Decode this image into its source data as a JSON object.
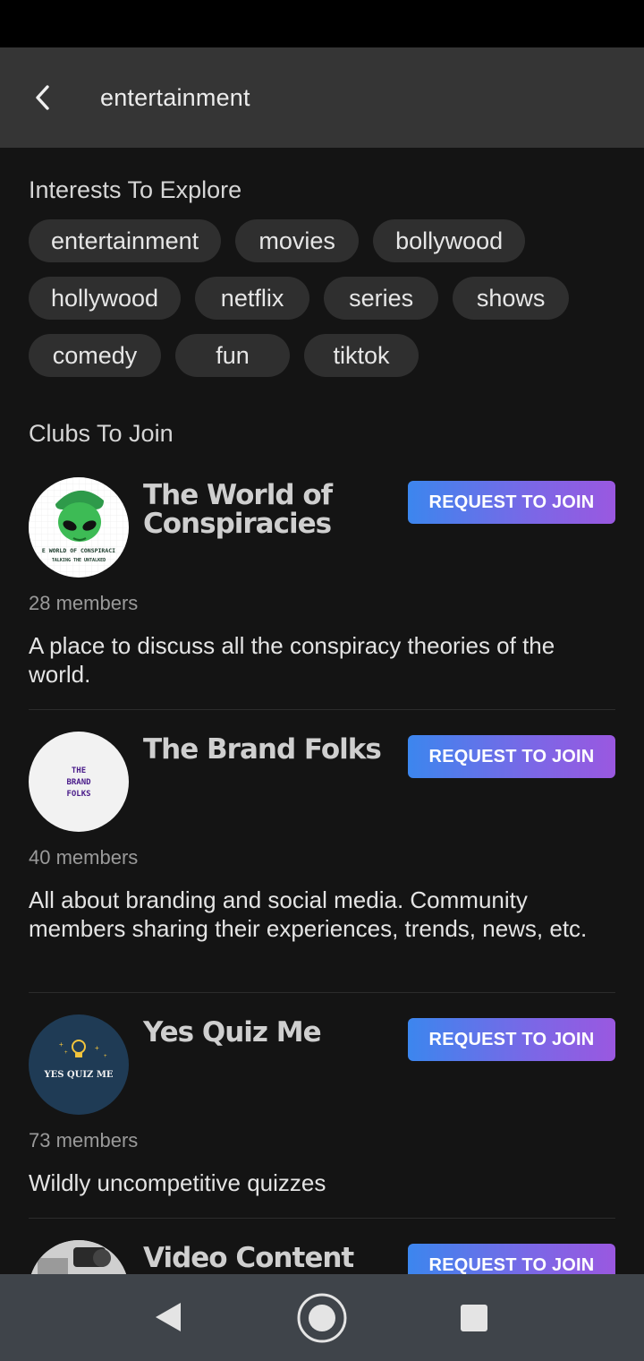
{
  "header": {
    "title": "entertainment",
    "back_icon": "chevron-left-icon"
  },
  "interests": {
    "title": "Interests To Explore",
    "rows": [
      [
        "entertainment",
        "movies",
        "bollywood"
      ],
      [
        "hollywood",
        "netflix",
        "series",
        "shows"
      ],
      [
        "comedy",
        "fun",
        "tiktok"
      ]
    ]
  },
  "clubs": {
    "title": "Clubs To Join",
    "join_label": "REQUEST TO JOIN",
    "items": [
      {
        "name": "The World of Conspiracies",
        "members": "28 members",
        "description": "A place to discuss all the conspiracy theories of the world.",
        "logo": {
          "line1": "E WORLD OF CONSPIRACI",
          "line2": "TALKING THE UNTALKED"
        }
      },
      {
        "name": "The Brand Folks",
        "members": "40 members",
        "description": "All about branding and social media. Community members sharing their experiences, trends, news, etc.",
        "logo": {
          "line1": "THE",
          "line2": "BRAND",
          "line3": "FOLKS"
        }
      },
      {
        "name": "Yes Quiz Me",
        "members": "73 members",
        "description": "Wildly uncompetitive quizzes",
        "logo": {
          "line1": "YES QUIZ ME"
        }
      },
      {
        "name": "Video Content",
        "members": "",
        "description": ""
      }
    ]
  },
  "colors": {
    "background": "#141414",
    "app_bar": "#353535",
    "chip": "#2f2f2f",
    "button_gradient_start": "#3c86ee",
    "button_gradient_end": "#9a58e0",
    "nav_bar": "#3f444a"
  },
  "nav": {
    "back_icon": "triangle-back-icon",
    "home_icon": "circle-home-icon",
    "recents_icon": "square-recents-icon"
  }
}
